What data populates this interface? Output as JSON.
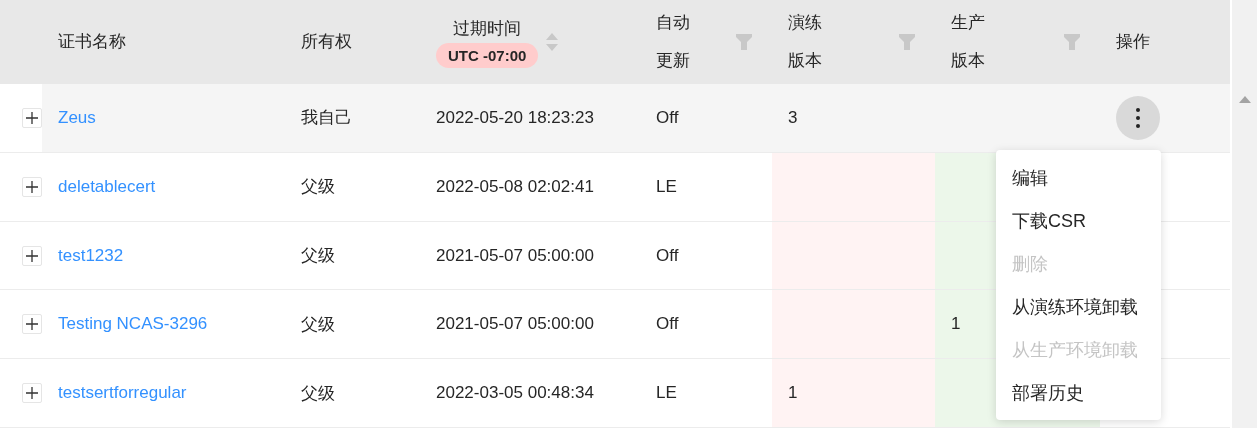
{
  "table": {
    "columns": [
      {
        "label": "证书名称",
        "kind": "plain"
      },
      {
        "label": "所有权",
        "kind": "plain"
      },
      {
        "label": "过期时间",
        "kind": "sort",
        "badge": "UTC -07:00"
      },
      {
        "label": "自动更新",
        "kind": "filter"
      },
      {
        "label": "演练版本",
        "kind": "filter"
      },
      {
        "label": "生产版本",
        "kind": "filter"
      },
      {
        "label": "操作",
        "kind": "plain"
      }
    ],
    "rows": [
      {
        "name": "Zeus",
        "owner": "我自己",
        "expiry": "2022-05-20 18:23:23",
        "auto_renew": "Off",
        "staging": "3",
        "hovered": true
      },
      {
        "name": "deletablecert",
        "owner": "父级",
        "expiry": "2022-05-08 02:02:41",
        "auto_renew": "LE",
        "hovered": false
      },
      {
        "name": "test1232",
        "owner": "父级",
        "expiry": "2021-05-07 05:00:00",
        "auto_renew": "Off",
        "hovered": false
      },
      {
        "name": "Testing NCAS-3296",
        "owner": "父级",
        "expiry": "2021-05-07 05:00:00",
        "auto_renew": "Off",
        "production": "1",
        "hovered": false
      },
      {
        "name": "testsertforregular",
        "owner": "父级",
        "expiry": "2022-03-05 00:48:34",
        "auto_renew": "LE",
        "staging": "1",
        "hovered": false
      }
    ]
  },
  "action_menu": {
    "items": [
      {
        "label": "编辑",
        "disabled": false
      },
      {
        "label": "下载CSR",
        "disabled": false
      },
      {
        "label": "删除",
        "disabled": true
      },
      {
        "label": "从演练环境卸载",
        "disabled": false
      },
      {
        "label": "从生产环境卸载",
        "disabled": true
      },
      {
        "label": "部署历史",
        "disabled": false
      }
    ]
  }
}
